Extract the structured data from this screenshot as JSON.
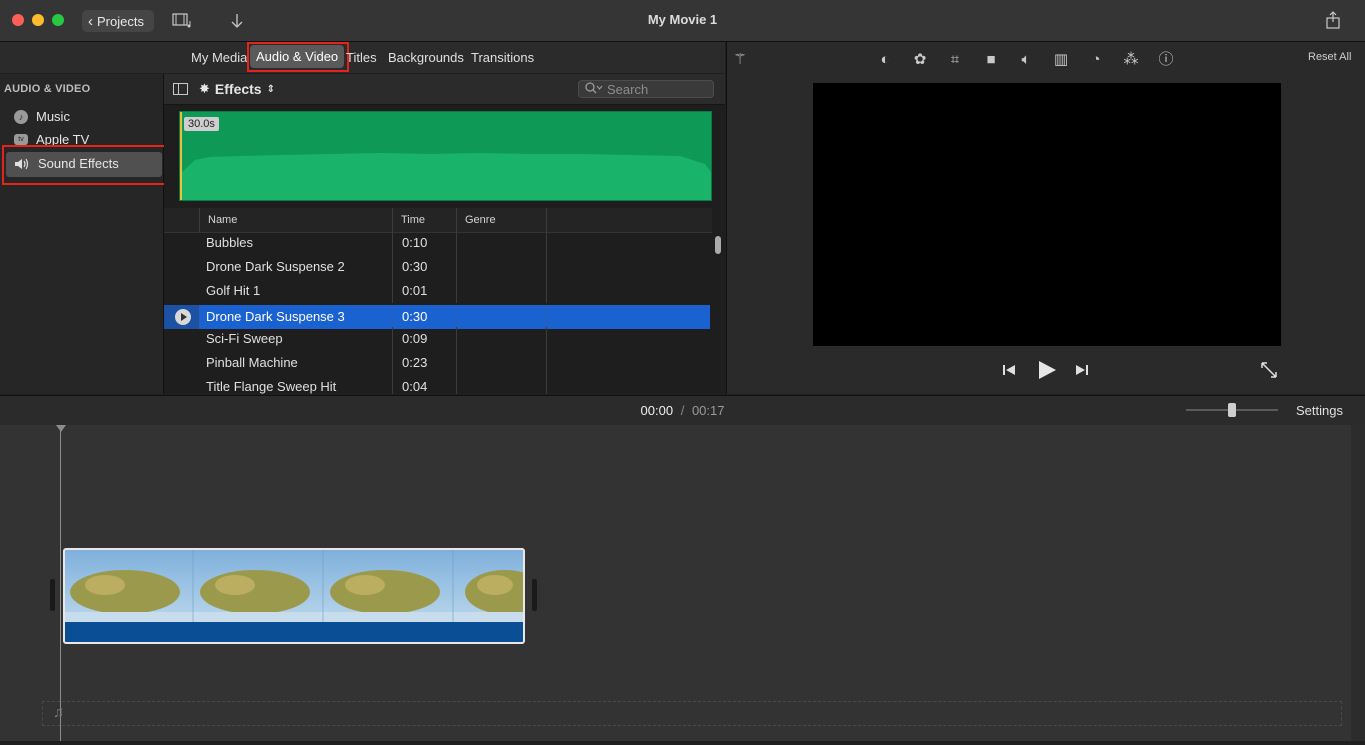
{
  "window": {
    "title": "My Movie 1",
    "back_label": "Projects"
  },
  "browser_tabs": [
    "My Media",
    "Audio & Video",
    "Titles",
    "Backgrounds",
    "Transitions"
  ],
  "sidebar": {
    "heading": "AUDIO & VIDEO",
    "items": [
      {
        "label": "Music",
        "icon": "music-note-icon"
      },
      {
        "label": "Apple TV",
        "icon": "apple-tv-icon"
      },
      {
        "label": "Sound Effects",
        "icon": "speaker-icon",
        "selected": true
      }
    ]
  },
  "content": {
    "category_label": "Effects",
    "search_placeholder": "Search",
    "preview_duration": "30.0s",
    "columns": [
      "Name",
      "Time",
      "Genre"
    ],
    "rows": [
      {
        "name": "Bubbles",
        "time": "0:10"
      },
      {
        "name": "Drone Dark Suspense 2",
        "time": "0:30"
      },
      {
        "name": "Golf Hit 1",
        "time": "0:01"
      },
      {
        "name": "Drone Dark Suspense 3",
        "time": "0:30",
        "selected": true
      },
      {
        "name": "Sci-Fi Sweep",
        "time": "0:09"
      },
      {
        "name": "Pinball Machine",
        "time": "0:23"
      },
      {
        "name": "Title Flange Sweep Hit",
        "time": "0:04"
      }
    ]
  },
  "viewer": {
    "reset_label": "Reset All"
  },
  "timeline": {
    "current_time": "00:00",
    "separator": "/",
    "total_time": "00:17",
    "settings_label": "Settings"
  },
  "colors": {
    "selection": "#1b62d1",
    "waveform": "#0e9a56",
    "highlight": "#e3231c"
  }
}
